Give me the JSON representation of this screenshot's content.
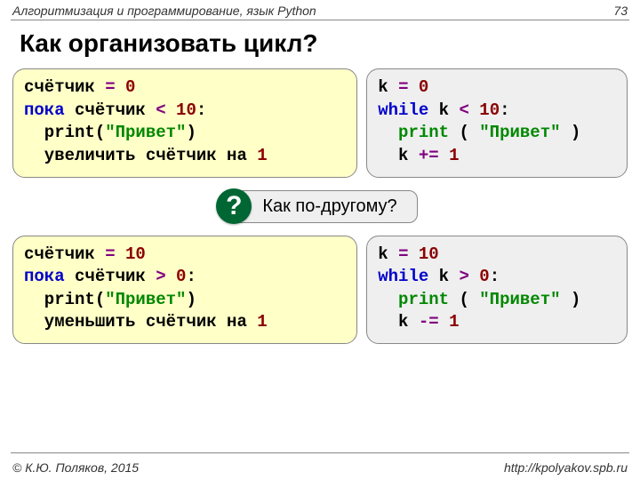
{
  "header": {
    "course": "Алгоритмизация и программирование, язык Python",
    "page": "73"
  },
  "title": "Как организовать цикл?",
  "block1": {
    "pseudo": {
      "l1a": "счётчик ",
      "l1b": "= ",
      "l1c": "0",
      "l2a": "пока ",
      "l2b": "счётчик ",
      "l2c": "< ",
      "l2d": "10",
      "l2e": ":",
      "l3a": "  print(",
      "l3b": "\"Привет\"",
      "l3c": ")",
      "l4a": "  увеличить счётчик на ",
      "l4b": "1"
    },
    "code": {
      "l1a": "k ",
      "l1b": "= ",
      "l1c": "0",
      "l2a": "while ",
      "l2b": "k ",
      "l2c": "< ",
      "l2d": "10",
      "l2e": ":",
      "l3a": "  print ",
      "l3b": "( ",
      "l3c": "\"Привет\"",
      "l3d": " )",
      "l4a": "  k ",
      "l4b": "+= ",
      "l4c": "1"
    }
  },
  "question": {
    "badge": "?",
    "text": "Как по-другому?"
  },
  "block2": {
    "pseudo": {
      "l1a": "счётчик ",
      "l1b": "= ",
      "l1c": "10",
      "l2a": "пока ",
      "l2b": "счётчик ",
      "l2c": "> ",
      "l2d": "0",
      "l2e": ":",
      "l3a": "  print(",
      "l3b": "\"Привет\"",
      "l3c": ")",
      "l4a": "  уменьшить счётчик на ",
      "l4b": "1"
    },
    "code": {
      "l1a": "k ",
      "l1b": "= ",
      "l1c": "10",
      "l2a": "while ",
      "l2b": "k ",
      "l2c": "> ",
      "l2d": "0",
      "l2e": ":",
      "l3a": "  print ",
      "l3b": "( ",
      "l3c": "\"Привет\"",
      "l3d": " )",
      "l4a": "  k ",
      "l4b": "-= ",
      "l4c": "1"
    }
  },
  "footer": {
    "copyright": "© К.Ю. Поляков, 2015",
    "url": "http://kpolyakov.spb.ru"
  }
}
